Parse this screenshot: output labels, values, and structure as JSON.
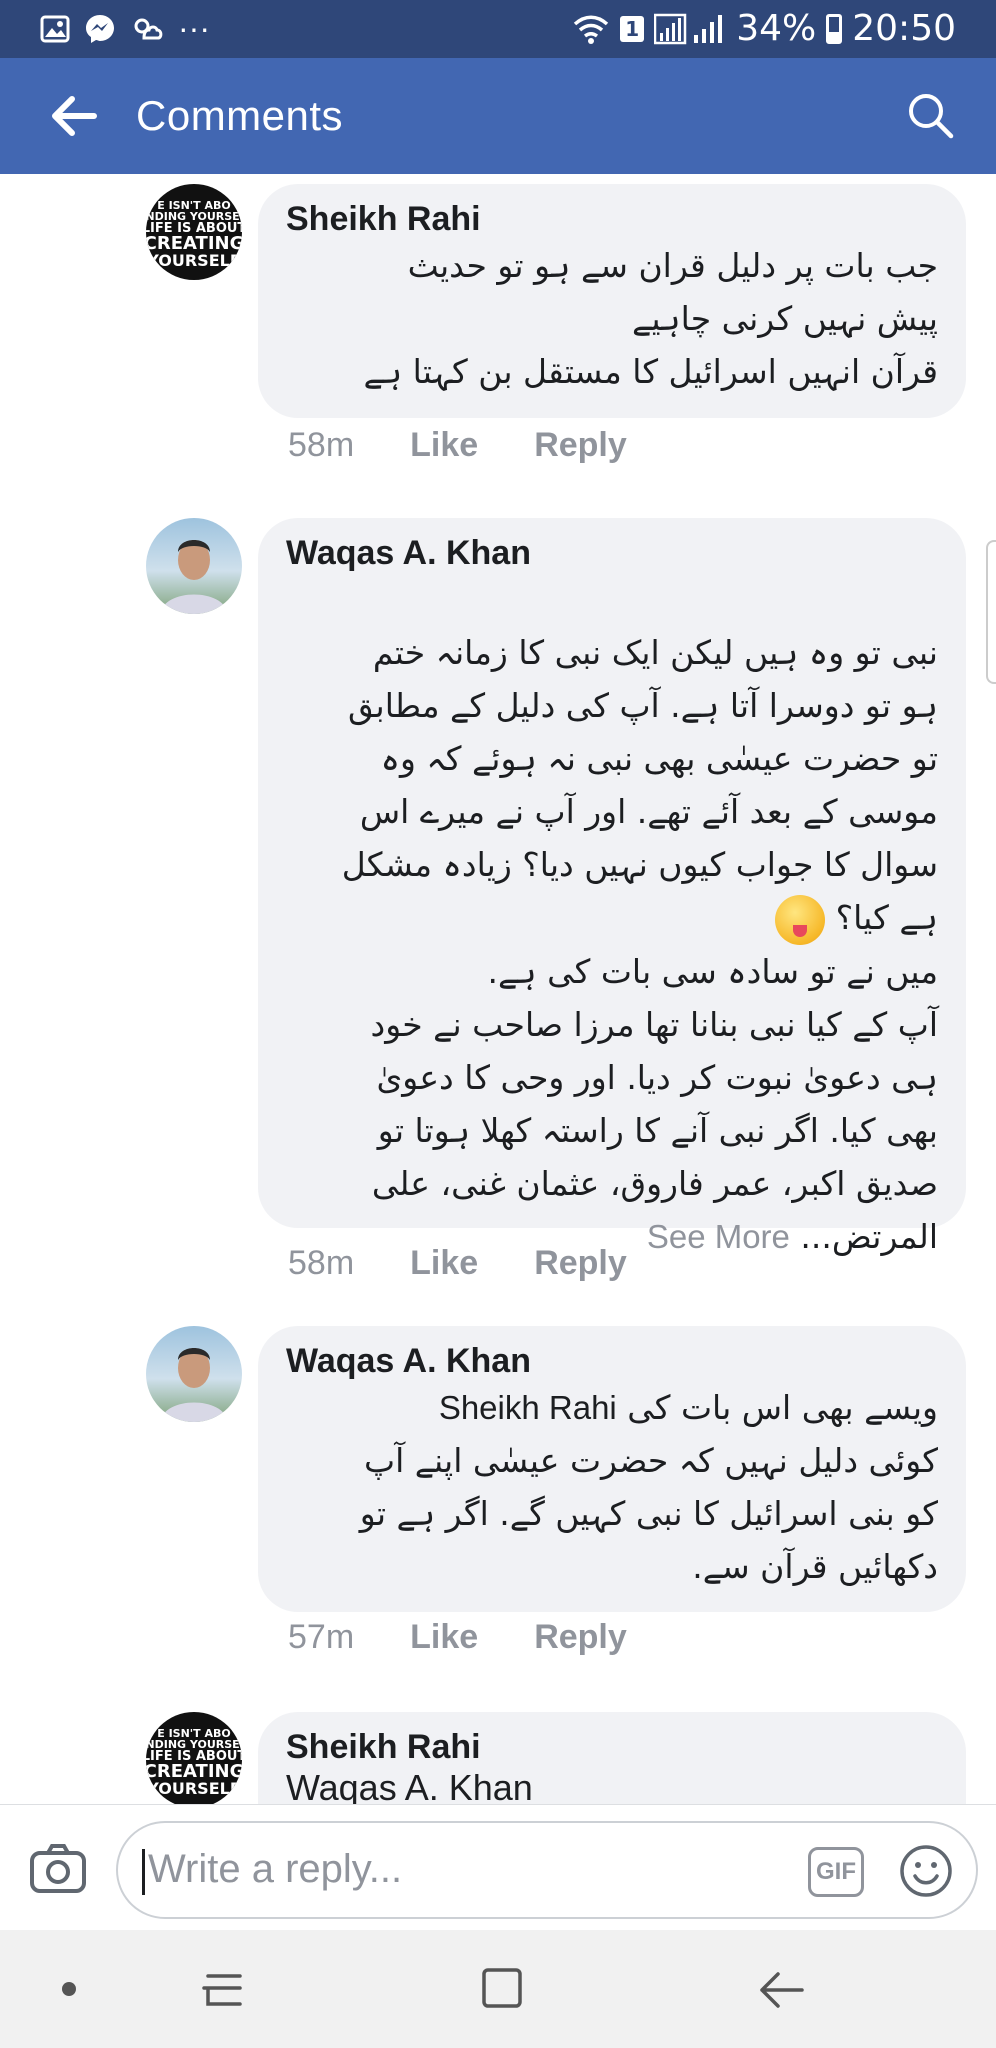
{
  "status_bar": {
    "sim_badge": "1",
    "battery": "34%",
    "time": "20:50",
    "overflow": "···"
  },
  "app_bar": {
    "title": "Comments"
  },
  "comments": [
    {
      "author": "Sheikh Rahi",
      "avatar_text": [
        "E ISN'T ABO",
        "FINDING YOURSELF",
        "LIFE IS ABOUT",
        "CREATING",
        "YOURSELF"
      ],
      "text": "جب بات پر دلیل قران سے ہو تو حدیث\nپیش نہیں کرنی چاہیے\nقرآن انہیں اسرائیل کا مستقل بن کہتا ہے",
      "time": "58m",
      "like": "Like",
      "reply": "Reply"
    },
    {
      "author": "Waqas A. Khan",
      "text": "نبی تو وہ ہیں لیکن ایک نبی کا زمانہ ختم\nہو تو دوسرا آتا ہے. آپ کی دلیل کے مطابق\nتو حضرت عیسٰی بھی نبی نہ ہوئے کہ وہ\nموسی کے بعد آئے تھے. اور آپ نے میرے اس\nسوال کا جواب کیوں نہیں دیا؟ زیادہ مشکل\nہے کیا؟",
      "text2": "میں نے تو سادہ سی بات کی ہے.\nآپ کے کیا نبی بنانا تھا مرزا صاحب نے خود\nہی دعویٰ نبوت کر دیا. اور وحی کا دعویٰ\nبھی کیا. اگر نبی آنے کا راستہ کھلا ہوتا تو\nصدیق اکبر، عمر فاروق، عثمان غنی، علی",
      "text_last": "المرتض...",
      "see_more": "See More",
      "time": "58m",
      "like": "Like",
      "reply": "Reply"
    },
    {
      "author": "Waqas A. Khan",
      "mention": "Sheikh Rahi",
      "text_first": "ویسے بھی اس بات کی",
      "text": "کوئی دلیل نہیں کہ حضرت عیسٰی اپنے آپ\nکو بنی اسرائیل کا نبی کہیں گے. اگر ہے تو\nدکھائیں قرآن سے.",
      "time": "57m",
      "like": "Like",
      "reply": "Reply"
    },
    {
      "author": "Sheikh Rahi",
      "avatar_text": [
        "E ISN'T ABO",
        "FINDING YOURSELF",
        "LIFE IS ABOUT",
        "CREATING",
        "YOURSELF"
      ],
      "partial_text": "Waqas A. Khan"
    }
  ],
  "composer": {
    "placeholder": "Write a reply...",
    "gif_label": "GIF"
  },
  "icons": {
    "status_left": [
      "gallery-icon",
      "messenger-icon",
      "weather-icon"
    ],
    "status_right": [
      "wifi-icon",
      "signal-icon",
      "battery-icon"
    ],
    "app_bar": [
      "back-arrow-icon",
      "search-icon"
    ],
    "composer": [
      "camera-icon",
      "gif-icon",
      "emoji-icon"
    ],
    "nav": [
      "nav-dot-icon",
      "recent-apps-icon",
      "home-icon",
      "back-icon"
    ]
  },
  "colors": {
    "status_bar": "#2f4779",
    "app_bar": "#4267b2",
    "bubble": "#f1f2f5",
    "meta": "#90949c"
  }
}
